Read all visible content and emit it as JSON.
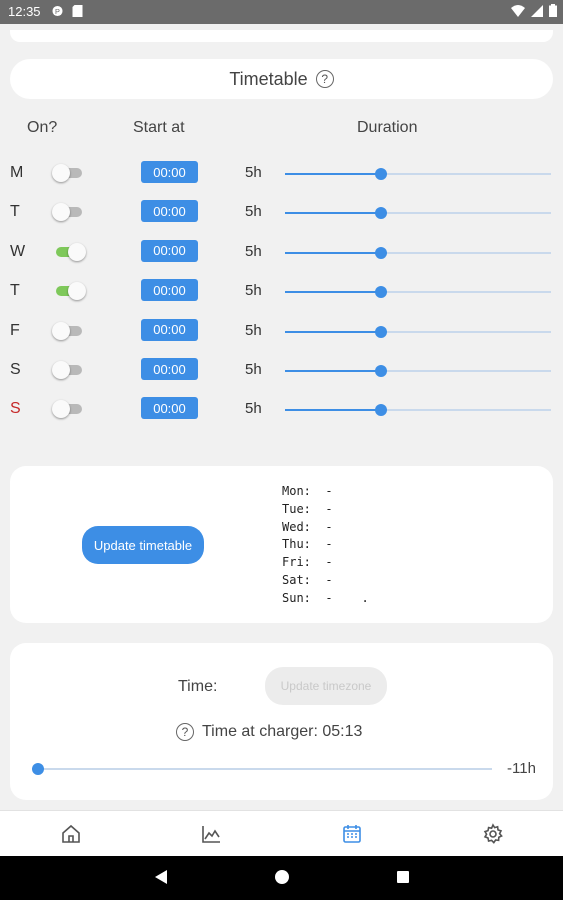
{
  "status_bar": {
    "time": "12:35"
  },
  "header": {
    "title": "Timetable"
  },
  "columns": {
    "on": "On?",
    "start": "Start at",
    "duration": "Duration"
  },
  "days": [
    {
      "label": "M",
      "on": false,
      "start": "00:00",
      "duration": "5h",
      "slider_fraction": 0.36,
      "color": "#333333"
    },
    {
      "label": "T",
      "on": false,
      "start": "00:00",
      "duration": "5h",
      "slider_fraction": 0.36,
      "color": "#333333"
    },
    {
      "label": "W",
      "on": true,
      "start": "00:00",
      "duration": "5h",
      "slider_fraction": 0.36,
      "color": "#333333"
    },
    {
      "label": "T",
      "on": true,
      "start": "00:00",
      "duration": "5h",
      "slider_fraction": 0.36,
      "color": "#333333"
    },
    {
      "label": "F",
      "on": false,
      "start": "00:00",
      "duration": "5h",
      "slider_fraction": 0.36,
      "color": "#333333"
    },
    {
      "label": "S",
      "on": false,
      "start": "00:00",
      "duration": "5h",
      "slider_fraction": 0.36,
      "color": "#333333"
    },
    {
      "label": "S",
      "on": false,
      "start": "00:00",
      "duration": "5h",
      "slider_fraction": 0.36,
      "color": "#c62828"
    }
  ],
  "timetable_card": {
    "update_button": "Update timetable",
    "summary": [
      "Mon:  -",
      "Tue:  -",
      "Wed:  -",
      "Thu:  -",
      "Fri:  -",
      "Sat:  -",
      "Sun:  -    ."
    ]
  },
  "time_card": {
    "time_label": "Time:",
    "update_timezone_button": "Update timezone",
    "charger_time": "Time at charger: 05:13",
    "offset_label": "-11h",
    "offset_slider_fraction": 0.0
  },
  "nav": [
    "home-icon",
    "chart-icon",
    "calendar-icon",
    "settings-icon"
  ],
  "colors": {
    "accent": "#3d8ee5",
    "toggle_on": "#7ec85a",
    "sunday": "#c62828"
  }
}
